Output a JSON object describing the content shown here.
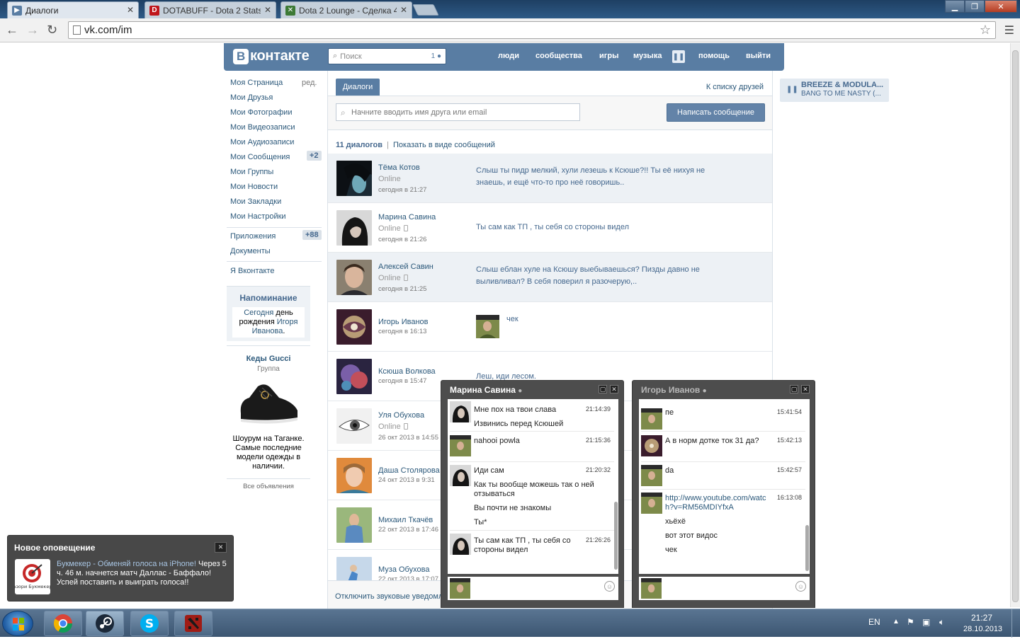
{
  "browser": {
    "tabs": [
      {
        "label": "Диалоги",
        "favicon": "vk-play-icon",
        "active": true
      },
      {
        "label": "DOTABUFF - Dota 2 Stats",
        "favicon": "dotabuff-icon",
        "active": false
      },
      {
        "label": "Dota 2 Lounge - Сделка 4",
        "favicon": "dota2lounge-icon",
        "active": false
      }
    ],
    "url": "vk.com/im"
  },
  "vk": {
    "logo": "контакте",
    "search_placeholder": "Поиск",
    "search_count": "1",
    "nav": [
      "люди",
      "сообщества",
      "игры",
      "музыка",
      "помощь",
      "выйти"
    ],
    "left_menu": [
      {
        "label": "Моя Страница",
        "extra": "ред."
      },
      {
        "label": "Мои Друзья"
      },
      {
        "label": "Мои Фотографии"
      },
      {
        "label": "Мои Видеозаписи"
      },
      {
        "label": "Мои Аудиозаписи"
      },
      {
        "label": "Мои Сообщения",
        "badge": "+2"
      },
      {
        "label": "Мои Группы"
      },
      {
        "label": "Мои Новости"
      },
      {
        "label": "Мои Закладки"
      },
      {
        "label": "Мои Настройки"
      },
      {
        "label": "Приложения",
        "badge": "+88"
      },
      {
        "label": "Документы"
      },
      {
        "label": "Я Вконтакте"
      }
    ],
    "reminder": {
      "title": "Напоминание",
      "link1": "Сегодня",
      "text1": " день рождения ",
      "link2": "Игоря Иванова",
      "text2": "."
    },
    "ad": {
      "title": "Кеды Gucci",
      "subtitle": "Группа",
      "body": "Шоурум на Таганке. Самые последние модели одежды в наличии.",
      "all_ads": "Все объявления"
    },
    "dialogs": {
      "tab": "Диалоги",
      "to_friends": "К списку друзей",
      "finder_placeholder": "Начните вводить имя друга или email",
      "write_button": "Написать сообщение",
      "count": "11 диалогов",
      "sep": "|",
      "show_as_messages": "Показать в виде сообщений",
      "items": [
        {
          "name": "Тёма Котов",
          "status": "Online",
          "time": "сегодня в 21:27",
          "text": "Слыш ты пидр мелкий, хули лезешь к Ксюше?!! Ты её нихуя не знаешь, и ещё что-то про неё говоришь..",
          "unread": true
        },
        {
          "name": "Марина Савина",
          "status": "Online",
          "time": "сегодня в 21:26",
          "text": "Ты сам как ТП , ты себя со стороны видел",
          "unread": false
        },
        {
          "name": "Алексей Савин",
          "status": "Online",
          "time": "сегодня в 21:25",
          "text": "Слыш еблан хуле на Ксюшу выебываешься? Пизды давно не выливливал? В себя поверил я разочерую,..",
          "unread": true
        },
        {
          "name": "Игорь Иванов",
          "status": "",
          "time": "сегодня в 16:13",
          "text": "чек",
          "unread": false
        },
        {
          "name": "Ксюша Волкова",
          "status": "",
          "time": "сегодня в 15:47",
          "text": "Леш, иди лесом.",
          "unread": false
        },
        {
          "name": "Уля Обухова",
          "status": "Online",
          "time": "26 окт 2013 в 14:55",
          "text": "",
          "unread": false
        },
        {
          "name": "Даша Столярова",
          "status": "",
          "time": "24 окт 2013 в 9:31",
          "text": "",
          "unread": false
        },
        {
          "name": "Михаил Ткачёв",
          "status": "",
          "time": "22 окт 2013 в 17:46",
          "text": "",
          "unread": false
        },
        {
          "name": "Муза Обухова",
          "status": "",
          "time": "22 окт 2013 в 17:07",
          "text": "",
          "unread": false
        }
      ],
      "footer": "Отключить звуковые уведомления"
    },
    "player": {
      "artist": "BREEZE & MODULA...",
      "track": "BANG TO ME NASTY (..."
    }
  },
  "chats": [
    {
      "title": "Марина Савина",
      "messages": [
        {
          "lines": [
            "Мне пох на твои слава",
            "Извинись перед Ксюшей"
          ],
          "time": "21:14:39",
          "who": "marina"
        },
        {
          "lines": [
            "nahooi powla"
          ],
          "time": "21:15:36",
          "who": "me"
        },
        {
          "lines": [
            "Иди сам",
            "Как ты вообще можешь так о ней отзываться",
            "Вы почти не знакомы",
            "Ты*"
          ],
          "time": "21:20:32",
          "who": "marina"
        },
        {
          "lines": [
            "Ты сам как ТП , ты себя со стороны видел"
          ],
          "time": "21:26:26",
          "who": "marina"
        }
      ]
    },
    {
      "title": "Игорь Иванов",
      "messages": [
        {
          "lines": [
            "пе"
          ],
          "time": "15:41:54",
          "who": "me"
        },
        {
          "lines": [
            "А в норм дотке ток 31 да?"
          ],
          "time": "15:42:13",
          "who": "igor"
        },
        {
          "lines": [
            "da"
          ],
          "time": "15:42:57",
          "who": "me"
        },
        {
          "lines": [
            "http://www.youtube.com/watch?v=RM56MDIYfxA",
            "хьёхё",
            "вот этот видос",
            "чек"
          ],
          "time": "16:13:08",
          "who": "me"
        }
      ]
    }
  ],
  "notification": {
    "title": "Новое оповещение",
    "link": "Букмекер - Обменяй голоса на iPhone!",
    "text": " Через 5 ч. 46 м. начнется матч Даллас - Баффало! Успей поставить и выиграть голоса!!",
    "image_label": "Разори Букмекера"
  },
  "taskbar": {
    "lang": "EN",
    "time": "21:27",
    "date": "28.10.2013"
  },
  "colors": {
    "vk_blue": "#597da3",
    "link": "#2b587a",
    "unread_bg": "#edf1f5"
  }
}
